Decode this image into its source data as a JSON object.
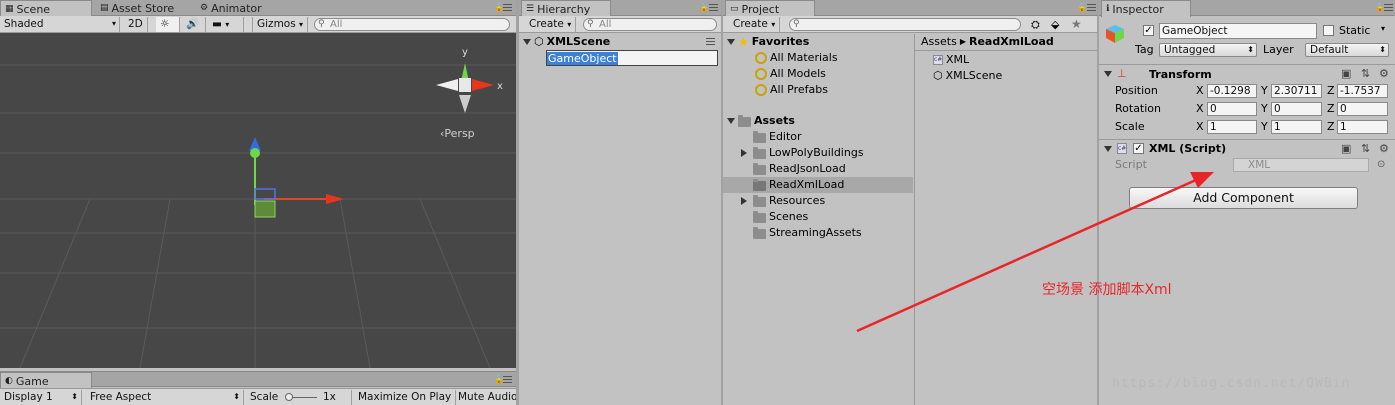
{
  "scene": {
    "tabs": [
      "Scene",
      "Asset Store",
      "Animator"
    ],
    "toolbar": {
      "shading": "Shaded",
      "mode_2d": "2D",
      "gizmos": "Gizmos",
      "search_placeholder": "All"
    },
    "persp_label": "Persp",
    "axis_y": "y",
    "axis_x": "x"
  },
  "game": {
    "tab": "Game",
    "display": "Display 1",
    "aspect": "Free Aspect",
    "scale_label": "Scale",
    "scale_value": "1x",
    "maximize": "Maximize On Play",
    "mute": "Mute Audio"
  },
  "hierarchy": {
    "tab": "Hierarchy",
    "create": "Create",
    "search_placeholder": "All",
    "scene_name": "XMLScene",
    "items": [
      "GameObject"
    ]
  },
  "project": {
    "tab": "Project",
    "create": "Create",
    "favorites_label": "Favorites",
    "favorites": [
      "All Materials",
      "All Models",
      "All Prefabs"
    ],
    "assets_label": "Assets",
    "folders": [
      {
        "name": "Editor",
        "expandable": false
      },
      {
        "name": "LowPolyBuildings",
        "expandable": true
      },
      {
        "name": "ReadJsonLoad",
        "expandable": false
      },
      {
        "name": "ReadXmlLoad",
        "expandable": false,
        "selected": true
      },
      {
        "name": "Resources",
        "expandable": true
      },
      {
        "name": "Scenes",
        "expandable": false
      },
      {
        "name": "StreamingAssets",
        "expandable": false
      }
    ],
    "breadcrumb": {
      "root": "Assets",
      "current": "ReadXmlLoad"
    },
    "files": [
      {
        "name": "XML",
        "icon": "csharp-script-icon"
      },
      {
        "name": "XMLScene",
        "icon": "unity-scene-icon"
      }
    ]
  },
  "inspector": {
    "tab": "Inspector",
    "object_name": "GameObject",
    "static_label": "Static",
    "tag_label": "Tag",
    "tag_value": "Untagged",
    "layer_label": "Layer",
    "layer_value": "Default",
    "transform": {
      "title": "Transform",
      "position": {
        "label": "Position",
        "x": "-0.1298",
        "y": "2.30711",
        "z": "-1.7537"
      },
      "rotation": {
        "label": "Rotation",
        "x": "0",
        "y": "0",
        "z": "0"
      },
      "scale": {
        "label": "Scale",
        "x": "1",
        "y": "1",
        "z": "1"
      },
      "axis_x": "X",
      "axis_y": "Y",
      "axis_z": "Z"
    },
    "script_component": {
      "title": "XML (Script)",
      "script_label": "Script",
      "script_value": "XML"
    },
    "add_component": "Add Component"
  },
  "annotation": {
    "text": "空场景 添加脚本Xml",
    "color": "#e8262a"
  },
  "watermark": "https://blog.csdn.net/QWBin"
}
